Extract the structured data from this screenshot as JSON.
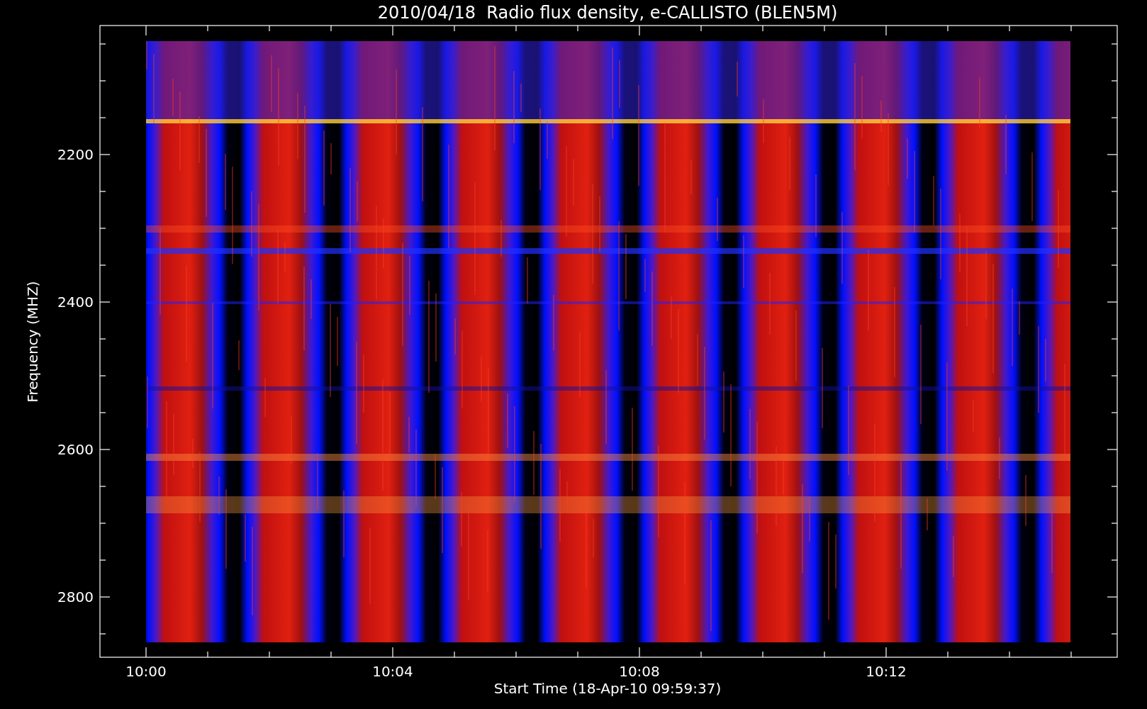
{
  "title": "2010/04/18  Radio flux density, e-CALLISTO (BLEN5M)",
  "y_axis": {
    "label": "Frequency (MHZ)",
    "ticks": [
      "2200",
      "2400",
      "2600",
      "2800"
    ]
  },
  "x_axis": {
    "label": "Start Time (18-Apr-10 09:59:37)",
    "ticks": [
      "10:00",
      "10:04",
      "10:08",
      "10:12"
    ]
  }
}
